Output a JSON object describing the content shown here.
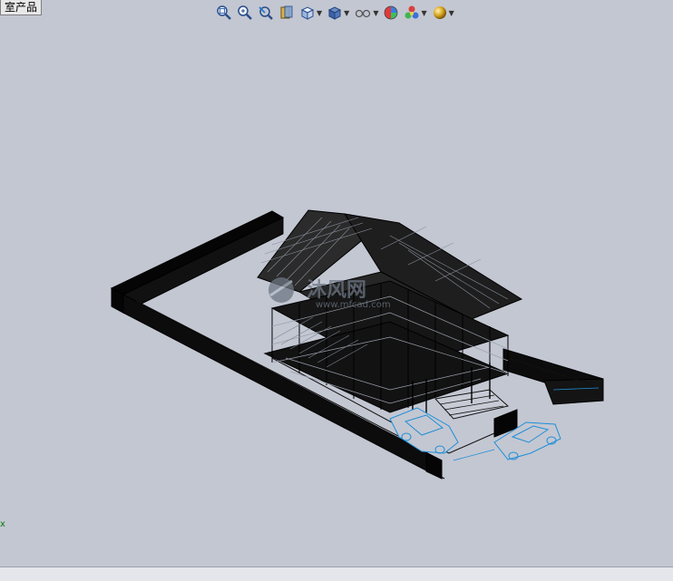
{
  "tab": {
    "label": "室产品"
  },
  "toolbar": {
    "buttons": [
      {
        "icon": "zoom-to-fit-icon"
      },
      {
        "icon": "zoom-to-area-icon"
      },
      {
        "icon": "previous-view-icon"
      },
      {
        "icon": "section-view-icon"
      },
      {
        "icon": "view-orientation-icon",
        "has_menu": true
      },
      {
        "icon": "display-style-icon",
        "has_menu": true
      },
      {
        "icon": "hide-show-items-icon",
        "has_menu": true
      },
      {
        "icon": "edit-appearance-icon"
      },
      {
        "icon": "apply-scene-icon",
        "has_menu": true
      },
      {
        "icon": "view-settings-icon",
        "has_menu": true
      }
    ]
  },
  "viewport": {
    "model": "isometric wireframe house assembly",
    "watermark": {
      "main": "沐风网",
      "sub": "www.mfcad.com"
    }
  },
  "triad": {
    "label": "x"
  },
  "colors": {
    "background": "#c3c7d2",
    "wire": "#000000",
    "highlight": "#1e8fd6",
    "triad": "#0a7a0a"
  }
}
